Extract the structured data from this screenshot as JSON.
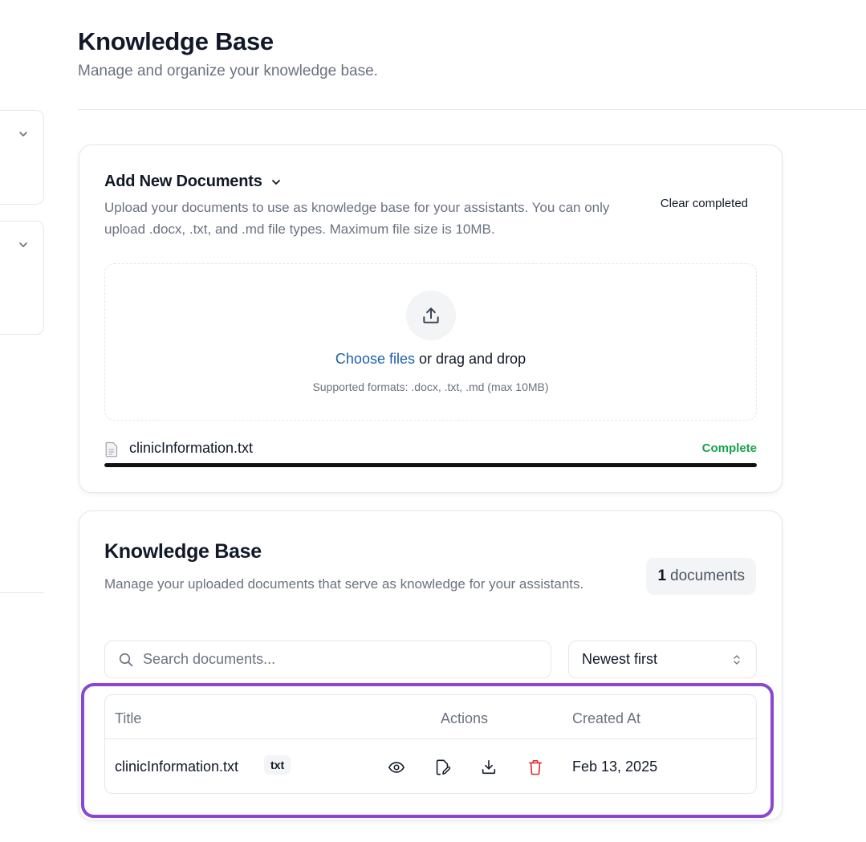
{
  "header": {
    "title": "Knowledge Base",
    "subtitle": "Manage and organize your knowledge base."
  },
  "upload": {
    "title": "Add New Documents",
    "description": "Upload your documents to use as knowledge base for your assistants. You can only upload .docx, .txt, and .md file types. Maximum file size is 10MB.",
    "clear_label": "Clear completed",
    "choose_label": "Choose files",
    "drag_label": " or drag and drop",
    "formats": "Supported formats: .docx, .txt, .md (max 10MB)",
    "file": {
      "name": "clinicInformation.txt",
      "status": "Complete",
      "progress": 1.0
    }
  },
  "knowledge": {
    "title": "Knowledge Base",
    "description": "Manage your uploaded documents that serve as knowledge for your assistants.",
    "count": "1",
    "count_label": "documents",
    "search_placeholder": "Search documents...",
    "sort_value": "Newest first",
    "columns": {
      "title": "Title",
      "actions": "Actions",
      "created": "Created At"
    },
    "rows": [
      {
        "name": "clinicInformation.txt",
        "type": "txt",
        "created": "Feb 13, 2025"
      }
    ]
  },
  "colors": {
    "link": "#1e5fa8",
    "success": "#16a34a",
    "danger": "#dc2626",
    "highlight": "#8b47d1"
  },
  "icons": [
    "chevron-down-icon",
    "upload-icon",
    "file-icon",
    "search-icon",
    "sort-icon",
    "eye-icon",
    "file-edit-icon",
    "download-icon",
    "trash-icon"
  ]
}
